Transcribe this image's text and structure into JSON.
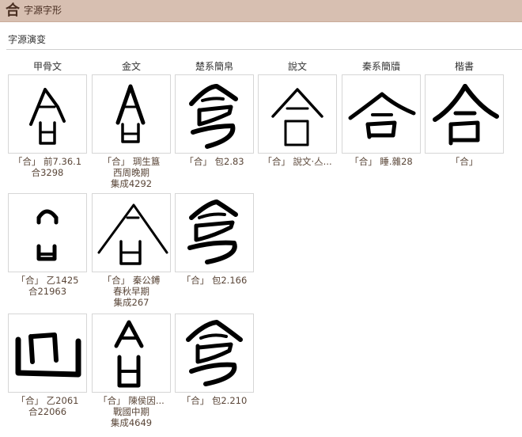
{
  "header": {
    "glyph": "合",
    "title": "字源字形"
  },
  "section": {
    "title": "字源演变"
  },
  "columns": [
    "甲骨文",
    "金文",
    "楚系簡帛",
    "說文",
    "秦系簡牘",
    "楷書"
  ],
  "rows": [
    [
      {
        "lines": [
          "「合」 前7.36.1",
          "合3298"
        ],
        "glyph_icon": "oracle-he-glyph-icon"
      },
      {
        "lines": [
          "「合」 琱生簋",
          "西周晚期",
          "集成4292"
        ],
        "glyph_icon": "bronze-he-glyph-icon"
      },
      {
        "lines": [
          "「合」 包2.83"
        ],
        "glyph_icon": "chu-he-glyph-icon"
      },
      {
        "lines": [
          "「合」 說文‧亼..."
        ],
        "glyph_icon": "shuowen-he-glyph-icon"
      },
      {
        "lines": [
          "「合」 睡.雜28"
        ],
        "glyph_icon": "qin-he-glyph-icon"
      },
      {
        "lines": [
          "「合」"
        ],
        "glyph_icon": "kaishu-he-glyph-icon"
      }
    ],
    [
      {
        "lines": [
          "「合」 乙1425",
          "合21963"
        ],
        "glyph_icon": "oracle-he-glyph-icon"
      },
      {
        "lines": [
          "「合」 秦公鎛",
          "春秋早期",
          "集成267"
        ],
        "glyph_icon": "bronze-he-glyph-icon"
      },
      {
        "lines": [
          "「合」 包2.166"
        ],
        "glyph_icon": "chu-he-glyph-icon"
      }
    ],
    [
      {
        "lines": [
          "「合」 乙2061",
          "合22066"
        ],
        "glyph_icon": "oracle-he-glyph-icon"
      },
      {
        "lines": [
          "「合」 陳侯因...",
          "戰國中期",
          "集成4649"
        ],
        "glyph_icon": "bronze-he-glyph-icon"
      },
      {
        "lines": [
          "「合」 包2.210"
        ],
        "glyph_icon": "chu-he-glyph-icon"
      }
    ]
  ]
}
